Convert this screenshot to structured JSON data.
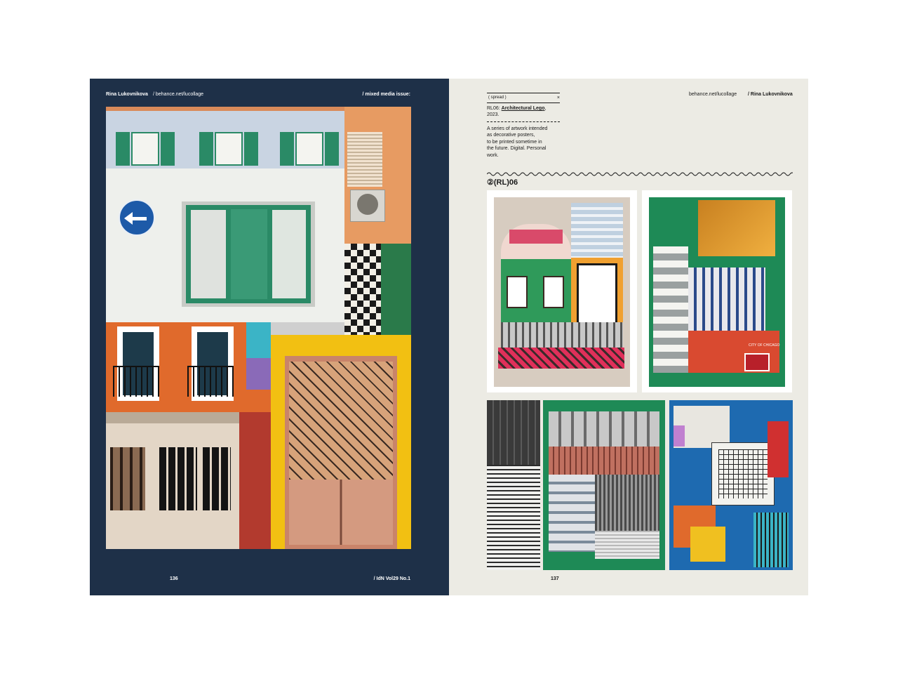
{
  "left_page": {
    "author": "Rina Lukovnikova",
    "url": "/ behance.net/lucollage",
    "section": "/ mixed media issue:",
    "page_number": "136",
    "issue": "/ IdN Vol29 No.1"
  },
  "right_page": {
    "url": "behance.net/lucollage",
    "author": "/ Rina Lukovnikova",
    "tag": "( spread )",
    "close": "×",
    "code": "RL06:",
    "title": "Architectural Lego",
    "title_suffix": ",",
    "year": "2023.",
    "description_lines": [
      "A series of artwork intended",
      "as decorative posters,",
      "to be printed sometime in",
      "the future. Digital. Personal",
      "work."
    ],
    "series_label": "②(RL)06",
    "poster_sign": "CITY OF CHICAGO",
    "page_number": "137"
  },
  "colors": {
    "left_bg": "#1e3048",
    "right_bg": "#ecebe4",
    "green": "#2a8a66",
    "orange": "#e06a2c",
    "yellow": "#f2c012"
  }
}
